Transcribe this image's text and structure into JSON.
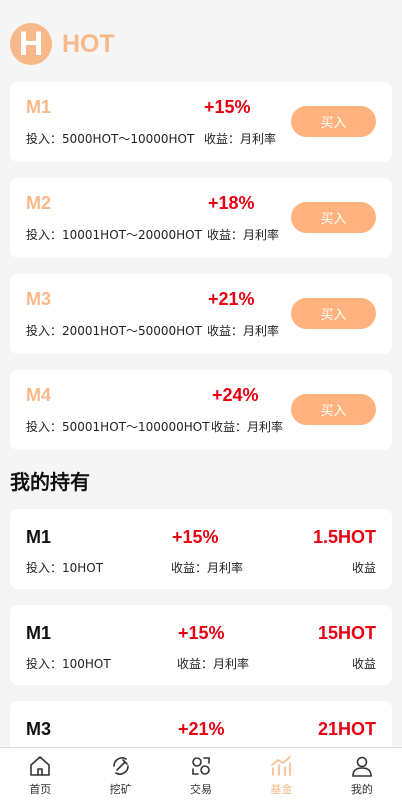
{
  "header": {
    "logo_letter": "H",
    "title": "HOT"
  },
  "funds": [
    {
      "name": "M1",
      "rate": "+15%",
      "range": "投入：5000HOT～10000HOT",
      "yield": "收益：月利率",
      "button": "买入"
    },
    {
      "name": "M2",
      "rate": "+18%",
      "range": "投入：10001HOT～20000HOT",
      "yield": "收益：月利率",
      "button": "买入"
    },
    {
      "name": "M3",
      "rate": "+21%",
      "range": "投入：20001HOT～50000HOT",
      "yield": "收益：月利率",
      "button": "买入"
    },
    {
      "name": "M4",
      "rate": "+24%",
      "range": "投入：50001HOT～100000HOT",
      "yield": "收益：月利率",
      "button": "买入"
    }
  ],
  "holdings_title": "我的持有",
  "holdings": [
    {
      "name": "M1",
      "rate": "+15%",
      "amount": "1.5HOT",
      "invest": "投入：10HOT",
      "yield": "收益：月利率",
      "income": "收益"
    },
    {
      "name": "M1",
      "rate": "+15%",
      "amount": "15HOT",
      "invest": "投入：100HOT",
      "yield": "收益：月利率",
      "income": "收益"
    },
    {
      "name": "M3",
      "rate": "+21%",
      "amount": "21HOT"
    }
  ],
  "tabs": [
    {
      "label": "首页",
      "icon": "home-icon"
    },
    {
      "label": "挖矿",
      "icon": "mining-icon"
    },
    {
      "label": "交易",
      "icon": "exchange-icon"
    },
    {
      "label": "基金",
      "icon": "fund-chart-icon",
      "active": true
    },
    {
      "label": "我的",
      "icon": "user-icon"
    }
  ],
  "colors": {
    "accent": "#f7b98a",
    "button": "#ffb27d",
    "rate_red": "#e60012",
    "background": "#f5f5f5"
  }
}
